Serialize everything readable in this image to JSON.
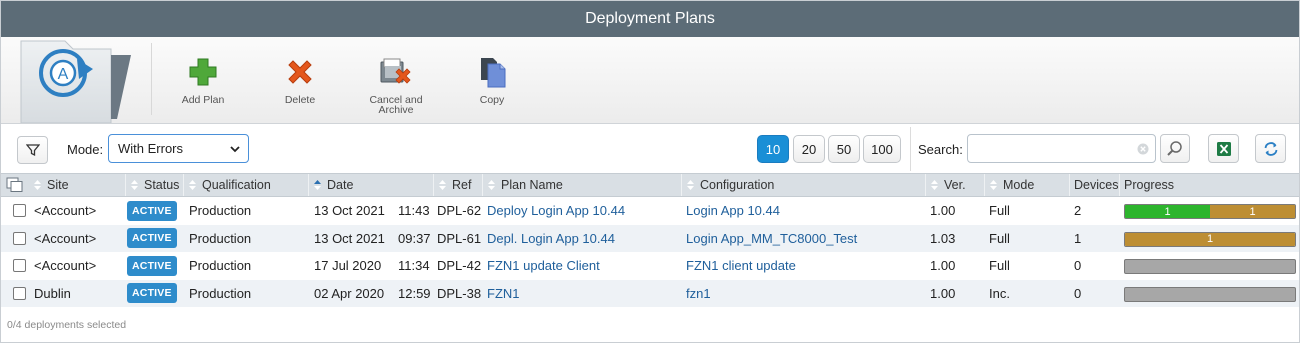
{
  "window": {
    "title": "Deployment Plans"
  },
  "toolbar": {
    "add_label": "Add Plan",
    "delete_label": "Delete",
    "cancel_archive_line1": "Cancel and",
    "cancel_archive_line2": "Archive",
    "copy_label": "Copy"
  },
  "filter": {
    "mode_label": "Mode:",
    "mode_value": "With Errors",
    "page_sizes": [
      "10",
      "20",
      "50",
      "100"
    ],
    "active_page_size": "10",
    "search_label": "Search:",
    "search_value": ""
  },
  "table": {
    "columns": [
      "Site",
      "Status",
      "Qualification",
      "Date",
      "Ref",
      "Plan Name",
      "Configuration",
      "Ver.",
      "Mode",
      "Devices",
      "Progress"
    ],
    "rows": [
      {
        "site": "<Account>",
        "status": "ACTIVE",
        "qualification": "Production",
        "date": "13 Oct 2021",
        "time": "11:43",
        "ref": "DPL-62",
        "plan_name": "Deploy Login App 10.44",
        "configuration": "Login App 10.44",
        "ver": "1.00",
        "mode": "Full",
        "devices": "2",
        "progress": [
          {
            "label": "1",
            "fraction": 0.5,
            "color": "#2db52d"
          },
          {
            "label": "1",
            "fraction": 0.5,
            "color": "#bd8e33"
          }
        ]
      },
      {
        "site": "<Account>",
        "status": "ACTIVE",
        "qualification": "Production",
        "date": "13 Oct 2021",
        "time": "09:37",
        "ref": "DPL-61",
        "plan_name": "Depl. Login App 10.44",
        "configuration": "Login App_MM_TC8000_Test",
        "ver": "1.03",
        "mode": "Full",
        "devices": "1",
        "progress": [
          {
            "label": "1",
            "fraction": 1.0,
            "color": "#bd8e33"
          }
        ]
      },
      {
        "site": "<Account>",
        "status": "ACTIVE",
        "qualification": "Production",
        "date": "17 Jul 2020",
        "time": "11:34",
        "ref": "DPL-42",
        "plan_name": "FZN1 update Client",
        "configuration": "FZN1 client update",
        "ver": "1.00",
        "mode": "Full",
        "devices": "0",
        "progress": []
      },
      {
        "site": "Dublin",
        "status": "ACTIVE",
        "qualification": "Production",
        "date": "02 Apr 2020",
        "time": "12:59",
        "ref": "DPL-38",
        "plan_name": "FZN1",
        "configuration": "fzn1",
        "ver": "1.00",
        "mode": "Inc.",
        "devices": "0",
        "progress": []
      }
    ]
  },
  "footer": {
    "selection_text": "0/4 deployments selected"
  },
  "colors": {
    "titlebar": "#5c6c77",
    "accent": "#1a8fd6",
    "badge": "#2e8ccb",
    "link": "#1f5f9b"
  },
  "icons": [
    "app-logo-icon",
    "add-icon",
    "delete-icon",
    "cancel-archive-icon",
    "copy-icon",
    "filter-icon",
    "search-icon",
    "clear-icon",
    "excel-icon",
    "refresh-icon",
    "select-all-icon",
    "sort-icon"
  ]
}
